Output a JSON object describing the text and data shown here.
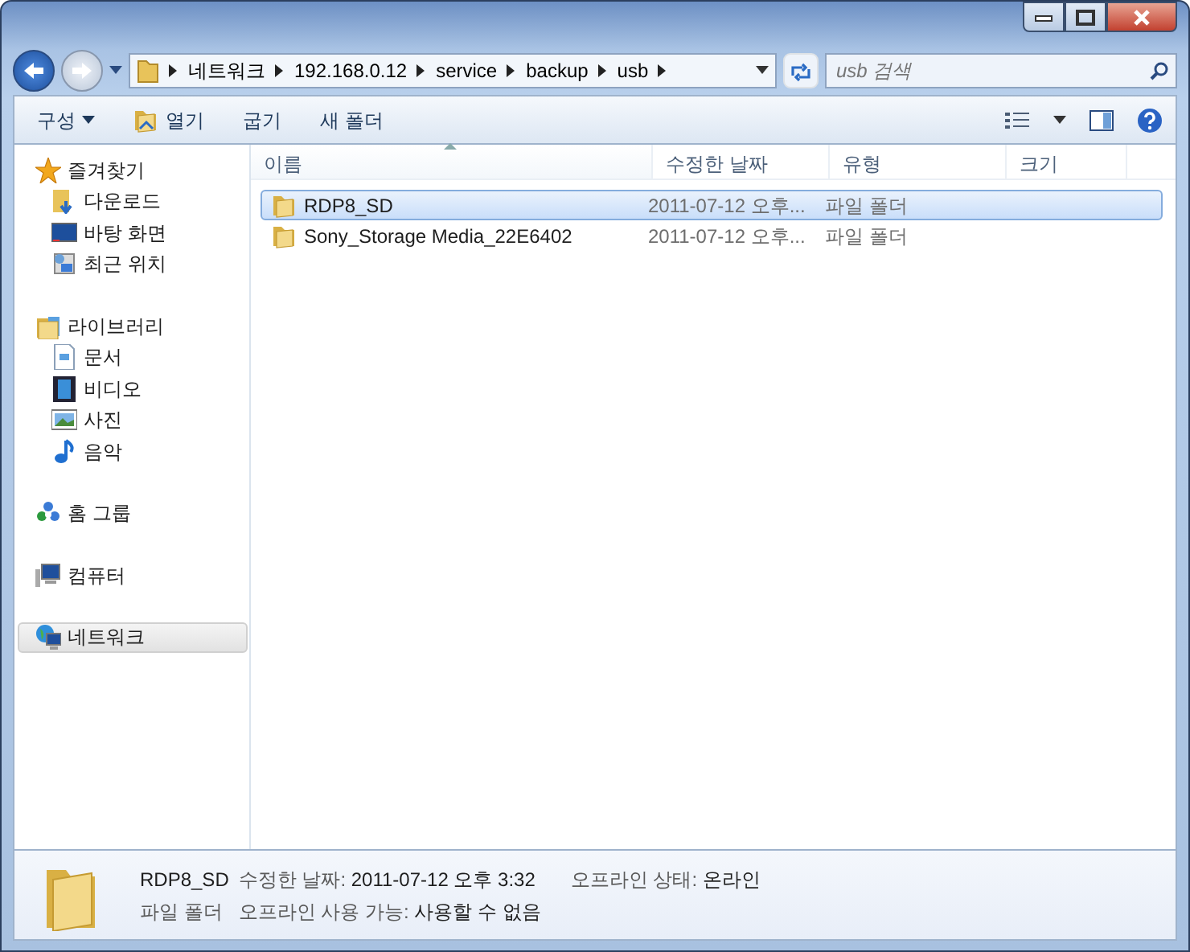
{
  "address": {
    "crumbs": [
      "네트워크",
      "192.168.0.12",
      "service",
      "backup",
      "usb"
    ]
  },
  "search": {
    "placeholder": "usb 검색"
  },
  "toolbar": [
    {
      "label": "구성",
      "kind": "menu"
    },
    {
      "label": "열기",
      "kind": "open"
    },
    {
      "label": "굽기",
      "kind": "plain"
    },
    {
      "label": "새 폴더",
      "kind": "plain"
    }
  ],
  "sidebar": [
    {
      "label": "즐겨찾기",
      "selected": false,
      "children": [
        {
          "label": "다운로드",
          "selected": false
        },
        {
          "label": "바탕 화면",
          "selected": false
        },
        {
          "label": "최근 위치",
          "selected": false
        }
      ]
    },
    {
      "label": "라이브러리",
      "selected": false,
      "children": [
        {
          "label": "문서",
          "selected": false
        },
        {
          "label": "비디오",
          "selected": false
        },
        {
          "label": "사진",
          "selected": false
        },
        {
          "label": "음악",
          "selected": false
        }
      ]
    },
    {
      "label": "홈 그룹",
      "selected": false
    },
    {
      "label": "컴퓨터",
      "selected": false
    },
    {
      "label": "네트워크",
      "selected": true
    }
  ],
  "table": {
    "columns": [
      {
        "label": "이름",
        "sorted": true
      },
      {
        "label": "수정한 날짜",
        "sorted": false
      },
      {
        "label": "유형",
        "sorted": false
      },
      {
        "label": "크기",
        "sorted": false
      }
    ],
    "rows": [
      {
        "name": "RDP8_SD",
        "modified": "2011-07-12 오후...",
        "type": "파일 폴더",
        "selected": true
      },
      {
        "name": "Sony_Storage Media_22E6402",
        "modified": "2011-07-12 오후...",
        "type": "파일 폴더",
        "selected": false
      }
    ]
  },
  "details": {
    "name": "RDP8_SD",
    "type": "파일 폴더",
    "properties": [
      {
        "label": "수정한 날짜:",
        "value": "2011-07-12 오후 3:32"
      },
      {
        "label": "오프라인 상태:",
        "value": "온라인"
      },
      {
        "label": "오프라인 사용 가능:",
        "value": "사용할 수 없음"
      }
    ]
  }
}
